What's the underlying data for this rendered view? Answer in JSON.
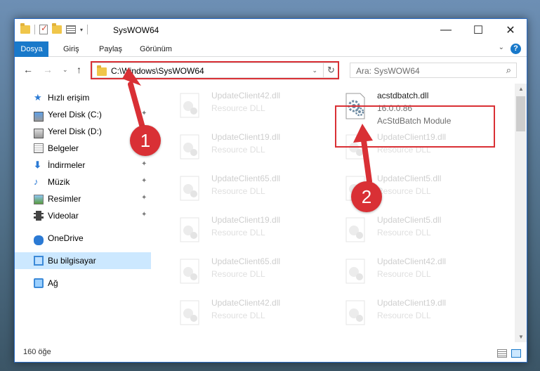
{
  "window": {
    "title": "SysWOW64"
  },
  "window_controls": {
    "minimize": "—",
    "maximize": "☐",
    "close": "✕"
  },
  "ribbon": {
    "tabs": [
      "Dosya",
      "Giriş",
      "Paylaş",
      "Görünüm"
    ],
    "help": "?",
    "expand": "⌄"
  },
  "address": {
    "path": "C:\\Windows\\SysWOW64",
    "dropdown": "⌄",
    "refresh": "↻"
  },
  "nav": {
    "back": "←",
    "forward": "→",
    "recent": "⌄",
    "up": "↑"
  },
  "search": {
    "placeholder": "Ara: SysWOW64",
    "icon": "⌕"
  },
  "sidebar": {
    "items": [
      {
        "label": "Hızlı erişim",
        "icon": "star-icon"
      },
      {
        "label": "Yerel Disk (C:)",
        "icon": "drive-icon",
        "pinned": true
      },
      {
        "label": "Yerel Disk (D:)",
        "icon": "drive-icon",
        "pinned": false
      },
      {
        "label": "Belgeler",
        "icon": "documents-icon",
        "pinned": false
      },
      {
        "label": "İndirmeler",
        "icon": "download-icon",
        "pinned": true
      },
      {
        "label": "Müzik",
        "icon": "music-icon",
        "pinned": true
      },
      {
        "label": "Resimler",
        "icon": "pictures-icon",
        "pinned": true
      },
      {
        "label": "Videolar",
        "icon": "videos-icon",
        "pinned": true
      },
      {
        "label": "OneDrive",
        "icon": "onedrive-icon"
      },
      {
        "label": "Bu bilgisayar",
        "icon": "this-pc-icon",
        "selected": true
      },
      {
        "label": "Ağ",
        "icon": "network-icon"
      }
    ],
    "pin_glyph": "📌"
  },
  "files": {
    "highlighted": {
      "name": "acstdbatch.dll",
      "version": "16.0.0.86",
      "description": "AcStdBatch Module"
    },
    "faded_left": [
      {
        "name": "UpdateClient42.dll",
        "type": "Resource DLL"
      },
      {
        "name": "UpdateClient19.dll",
        "type": "Resource DLL"
      },
      {
        "name": "UpdateClient65.dll",
        "type": "Resource DLL"
      },
      {
        "name": "UpdateClient19.dll",
        "type": "Resource DLL"
      },
      {
        "name": "UpdateClient65.dll",
        "type": "Resource DLL"
      },
      {
        "name": "UpdateClient42.dll",
        "type": "Resource DLL"
      }
    ],
    "faded_right": [
      {
        "name": "UpdateClient19.dll",
        "type": "Resource DLL"
      },
      {
        "name": "UpdateClient5.dll",
        "type": "Resource DLL"
      },
      {
        "name": "UpdateClient5.dll",
        "type": "Resource DLL"
      },
      {
        "name": "UpdateClient42.dll",
        "type": "Resource DLL"
      },
      {
        "name": "UpdateClient19.dll",
        "type": "Resource DLL"
      }
    ]
  },
  "status": {
    "count": "160 öğe"
  },
  "annotations": {
    "step1": "1",
    "step2": "2",
    "color": "#d93035"
  }
}
